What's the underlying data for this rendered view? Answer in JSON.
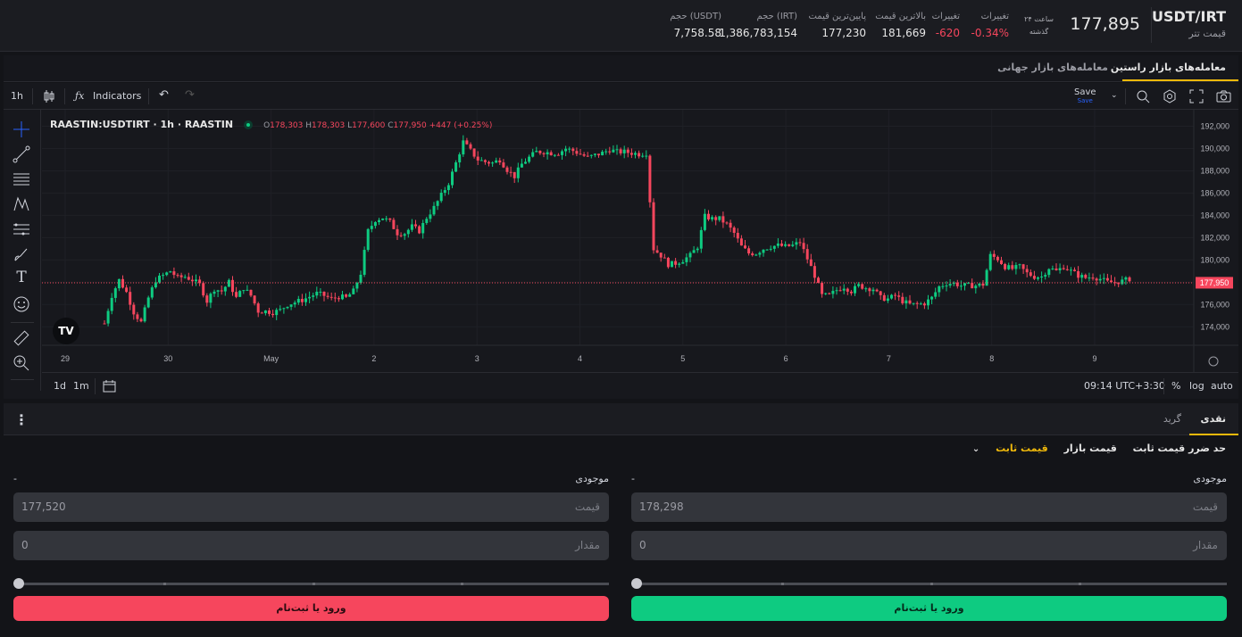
{
  "header": {
    "pair": "USDT/IRT",
    "pair_name": "قیمت تتر",
    "last_price": "177,895",
    "period_line1": "۲۴ ساعت",
    "period_line2": "گذشته",
    "stats": [
      {
        "label": "تغییرات",
        "value": "-0.34%",
        "color": "#f6465d"
      },
      {
        "label": "تغییرات",
        "value": "-620",
        "color": "#f6465d"
      },
      {
        "label": "بالاترین قیمت",
        "value": "181,669"
      },
      {
        "label": "پایین‌ترین قیمت",
        "value": "177,230"
      },
      {
        "label": "حجم (IRT)",
        "value": "1,386,783,154"
      },
      {
        "label": "حجم (USDT)",
        "value": "7,758.58"
      }
    ]
  },
  "tabs": {
    "raastin": "معامله‌های بازار راستین",
    "global": "معامله‌های بازار جهانی"
  },
  "toolbar": {
    "interval": "1h",
    "indicators": "Indicators",
    "save": "Save",
    "save_sub": "Save"
  },
  "legend": {
    "symbol": "RAASTIN:USDTIRT · 1h · RAASTIN",
    "o_label": "O",
    "o": "178,303",
    "h_label": "H",
    "h": "178,303",
    "l_label": "L",
    "l": "177,600",
    "c_label": "C",
    "c": "177,950",
    "change": "+447 (+0.25%)"
  },
  "chart_data": {
    "type": "candlestick",
    "price_axis": [
      "192,000",
      "190,000",
      "188,000",
      "186,000",
      "184,000",
      "182,000",
      "180,000",
      "178,000",
      "176,000",
      "174,000"
    ],
    "price_range": [
      172500,
      193000
    ],
    "time_axis": [
      "29",
      "30",
      "May",
      "2",
      "3",
      "4",
      "5",
      "6",
      "7",
      "8",
      "9"
    ],
    "current_price_label": "177,950",
    "current_price": 177950,
    "path_points": [
      [
        0,
        174300
      ],
      [
        2,
        176800
      ],
      [
        4,
        178200
      ],
      [
        6,
        177100
      ],
      [
        8,
        175300
      ],
      [
        10,
        174400
      ],
      [
        12,
        176600
      ],
      [
        14,
        178200
      ],
      [
        16,
        178600
      ],
      [
        18,
        179000
      ],
      [
        20,
        178400
      ],
      [
        22,
        178500
      ],
      [
        24,
        178200
      ],
      [
        26,
        177800
      ],
      [
        28,
        176300
      ],
      [
        30,
        177400
      ],
      [
        32,
        177200
      ],
      [
        34,
        178000
      ],
      [
        36,
        176600
      ],
      [
        38,
        177500
      ],
      [
        40,
        176800
      ],
      [
        42,
        175400
      ],
      [
        44,
        175400
      ],
      [
        46,
        175300
      ],
      [
        48,
        175500
      ],
      [
        50,
        176000
      ],
      [
        52,
        176200
      ],
      [
        54,
        176400
      ],
      [
        56,
        176700
      ],
      [
        58,
        177000
      ],
      [
        60,
        176800
      ],
      [
        62,
        176500
      ],
      [
        64,
        176700
      ],
      [
        66,
        176600
      ],
      [
        68,
        177200
      ],
      [
        70,
        178800
      ],
      [
        72,
        182600
      ],
      [
        74,
        183600
      ],
      [
        76,
        183800
      ],
      [
        78,
        183400
      ],
      [
        80,
        182400
      ],
      [
        82,
        182400
      ],
      [
        84,
        183000
      ],
      [
        86,
        182600
      ],
      [
        88,
        183800
      ],
      [
        90,
        184700
      ],
      [
        92,
        185800
      ],
      [
        94,
        186900
      ],
      [
        96,
        188700
      ],
      [
        98,
        190600
      ],
      [
        100,
        189800
      ],
      [
        102,
        189000
      ],
      [
        104,
        188800
      ],
      [
        106,
        188700
      ],
      [
        108,
        189000
      ],
      [
        110,
        188100
      ],
      [
        112,
        187500
      ],
      [
        114,
        188600
      ],
      [
        116,
        189200
      ],
      [
        118,
        189700
      ],
      [
        120,
        189700
      ],
      [
        122,
        189600
      ],
      [
        124,
        189600
      ],
      [
        126,
        190000
      ],
      [
        128,
        189800
      ],
      [
        130,
        189500
      ],
      [
        132,
        189200
      ],
      [
        134,
        189400
      ],
      [
        136,
        189600
      ],
      [
        138,
        189900
      ],
      [
        140,
        189700
      ],
      [
        142,
        189700
      ],
      [
        144,
        189600
      ],
      [
        146,
        189500
      ],
      [
        148,
        189600
      ],
      [
        150,
        181000
      ],
      [
        152,
        180400
      ],
      [
        154,
        179600
      ],
      [
        156,
        179700
      ],
      [
        158,
        180000
      ],
      [
        160,
        180400
      ],
      [
        162,
        181200
      ],
      [
        164,
        183900
      ],
      [
        166,
        183700
      ],
      [
        168,
        183700
      ],
      [
        170,
        183200
      ],
      [
        172,
        182400
      ],
      [
        174,
        181200
      ],
      [
        176,
        180600
      ],
      [
        178,
        180600
      ],
      [
        180,
        181000
      ],
      [
        182,
        181200
      ],
      [
        184,
        181300
      ],
      [
        186,
        181200
      ],
      [
        188,
        181300
      ],
      [
        190,
        181600
      ],
      [
        192,
        180100
      ],
      [
        194,
        178600
      ],
      [
        196,
        176800
      ],
      [
        198,
        176800
      ],
      [
        200,
        177300
      ],
      [
        202,
        177600
      ],
      [
        204,
        177200
      ],
      [
        206,
        177700
      ],
      [
        208,
        177500
      ],
      [
        210,
        177400
      ],
      [
        212,
        176600
      ],
      [
        214,
        176500
      ],
      [
        216,
        176800
      ],
      [
        218,
        176300
      ],
      [
        220,
        176000
      ],
      [
        222,
        176000
      ],
      [
        224,
        176100
      ],
      [
        226,
        176600
      ],
      [
        228,
        177600
      ],
      [
        230,
        177900
      ],
      [
        232,
        177900
      ],
      [
        234,
        177700
      ],
      [
        236,
        177700
      ],
      [
        238,
        177700
      ],
      [
        240,
        177800
      ],
      [
        242,
        180400
      ],
      [
        244,
        180100
      ],
      [
        246,
        179400
      ],
      [
        248,
        179200
      ],
      [
        250,
        179400
      ],
      [
        252,
        178800
      ],
      [
        254,
        178500
      ],
      [
        256,
        178500
      ],
      [
        258,
        179300
      ],
      [
        260,
        179000
      ],
      [
        262,
        179400
      ],
      [
        264,
        179000
      ],
      [
        266,
        178600
      ],
      [
        268,
        178400
      ],
      [
        270,
        178500
      ],
      [
        272,
        178300
      ],
      [
        274,
        178000
      ],
      [
        276,
        178000
      ],
      [
        278,
        178100
      ],
      [
        280,
        178300
      ]
    ]
  },
  "bottombar": {
    "range_1d": "1d",
    "range_1m": "1m",
    "timezone": "09:14 UTC+3:30",
    "percent": "%",
    "log": "log",
    "auto": "auto"
  },
  "order_tabs": {
    "spot": "نقدی",
    "grid": "گرید"
  },
  "order_types": {
    "limit": "قیمت ثابت",
    "market": "قیمت بازار",
    "stop_limit": "حد ضرر قیمت ثابت"
  },
  "buy_panel": {
    "balance_label": "موجودی",
    "balance_value": "-",
    "price_label": "قیمت",
    "price_value": "178,298",
    "amount_label": "مقدار",
    "amount_value": "0",
    "slider_percent": 0,
    "button": "ورود یا ثبت‌نام",
    "color": "#0ecb81"
  },
  "sell_panel": {
    "balance_label": "موجودی",
    "balance_value": "-",
    "price_label": "قیمت",
    "price_value": "177,520",
    "amount_label": "مقدار",
    "amount_value": "0",
    "slider_percent": 0,
    "button": "ورود یا ثبت‌نام",
    "color": "#f6465d"
  }
}
